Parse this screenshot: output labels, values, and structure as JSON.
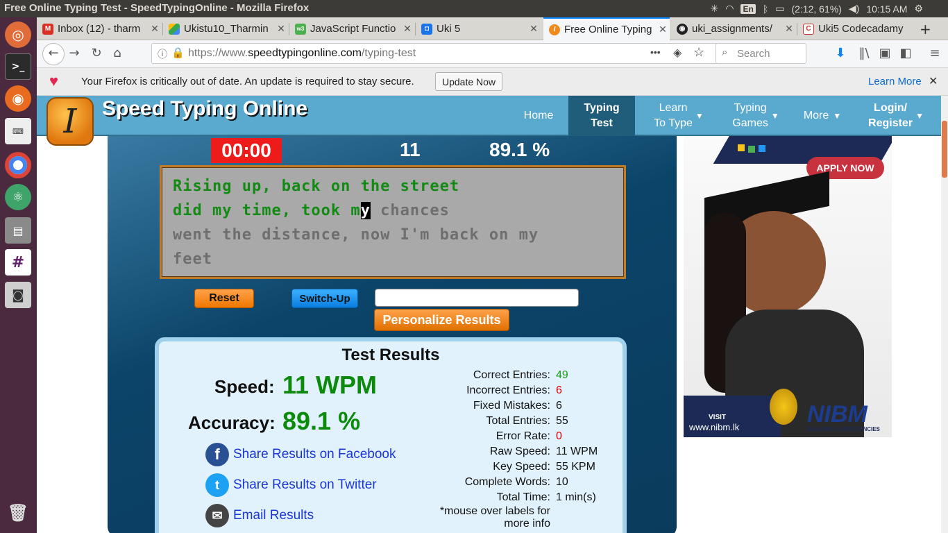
{
  "window": {
    "title": "Free Online Typing Test - SpeedTypingOnline - Mozilla Firefox"
  },
  "tray": {
    "lang": "En",
    "battery": "(2:12, 61%)",
    "time": "10:15 AM"
  },
  "launcher": {
    "items": [
      "ubuntu",
      "terminal",
      "firefox",
      "keyboard",
      "chrome",
      "atom",
      "files",
      "slack",
      "camera",
      "trash"
    ]
  },
  "tabs": [
    {
      "label": "Inbox (12) - tharm",
      "icon": "gmail-icon"
    },
    {
      "label": "Ukistu10_Tharmin",
      "icon": "drive-icon"
    },
    {
      "label": "JavaScript Functio",
      "icon": "w3-icon"
    },
    {
      "label": "Uki 5",
      "icon": "classroom-icon"
    },
    {
      "label": "Free Online Typing",
      "icon": "typing-icon"
    },
    {
      "label": "uki_assignments/",
      "icon": "github-icon"
    },
    {
      "label": "Uki5 Codecadamy",
      "icon": "codecademy-icon"
    }
  ],
  "nav": {
    "url_prefix": "https://www.",
    "url_domain": "speedtypingonline.com",
    "url_path": "/typing-test",
    "url_menu": "•••",
    "search_placeholder": "Search"
  },
  "notice": {
    "message": "Your Firefox is critically out of date. An update is required to stay secure.",
    "update_button": "Update Now",
    "learn_more": "Learn More"
  },
  "site": {
    "logo_letter": "I",
    "logo_text": "Speed Typing Online",
    "menu": {
      "home": "Home",
      "typing_test_1": "Typing",
      "typing_test_2": "Test",
      "learn_1": "Learn",
      "learn_2": "To Type",
      "games_1": "Typing",
      "games_2": "Games",
      "more": "More",
      "login_1": "Login/",
      "login_2": "Register",
      "arrow": "▼"
    }
  },
  "test": {
    "timer": "00:00",
    "wpm": "11",
    "accuracy": "89.1 %",
    "typed_line1": "Rising up, back on the street",
    "typed_line2": "did my time, took m",
    "cursor_char": "y",
    "rest_line2": " chances",
    "line3": "went the distance, now I'm back on my",
    "line4": "feet",
    "reset": "Reset",
    "switch_up": "Switch-Up",
    "name_input": "",
    "personalize": "Personalize Results"
  },
  "results": {
    "title": "Test Results",
    "speed_label": "Speed:",
    "speed_value": "11 WPM",
    "accuracy_label": "Accuracy:",
    "accuracy_value": "89.1 %",
    "share_facebook": "Share Results on Facebook",
    "share_twitter": "Share Results on Twitter",
    "email": "Email Results",
    "stats": [
      {
        "label": "Correct Entries:",
        "value": "49",
        "color": "#1a9a1a"
      },
      {
        "label": "Incorrect Entries:",
        "value": "6",
        "color": "#e00000"
      },
      {
        "label": "Fixed Mistakes:",
        "value": "6",
        "color": "#111111"
      },
      {
        "label": "Total Entries:",
        "value": "55",
        "color": "#111111"
      },
      {
        "label": "Error Rate:",
        "value": "0",
        "color": "#e00000"
      },
      {
        "label": "Raw Speed:",
        "value": "11 WPM",
        "color": "#111111"
      },
      {
        "label": "Key Speed:",
        "value": "55 KPM",
        "color": "#111111"
      },
      {
        "label": "Complete Words:",
        "value": "10",
        "color": "#111111"
      },
      {
        "label": "Total Time:",
        "value": "1 min(s)",
        "color": "#111111"
      }
    ],
    "note_1": "*mouse over labels for",
    "note_2": "more info"
  },
  "ad": {
    "apply_now": "APPLY NOW",
    "visit": "VISIT",
    "url": "www.nibm.lk",
    "brand": "NIBM",
    "tagline": "BUILDING COMPETENCIES"
  },
  "colors": {
    "accent": "#0a84ff",
    "site_header": "#5aa9cf",
    "timer": "#ee1b1b",
    "typed": "#138a13"
  }
}
